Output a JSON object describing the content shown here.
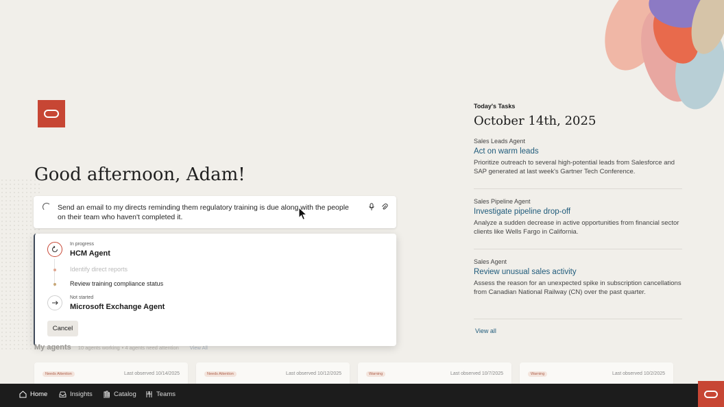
{
  "greeting": "Good afternoon, Adam!",
  "prompt": {
    "text": "Send an email to my directs reminding them regulatory training is due along with the people on their team who haven't completed it."
  },
  "progress": {
    "agents": [
      {
        "status": "In progress",
        "name": "HCM Agent",
        "steps": [
          {
            "label": "Identify direct reports",
            "state": "done"
          },
          {
            "label": "Review training compliance status",
            "state": "current"
          }
        ]
      },
      {
        "status": "Not started",
        "name": "Microsoft Exchange Agent",
        "steps": []
      }
    ],
    "cancel_label": "Cancel"
  },
  "my_agents": {
    "title": "My agents",
    "count": "10 agents working",
    "attention": "• 4 agents need attention",
    "view_all": "View All",
    "cards": [
      {
        "badge": "Needs Attention",
        "observed": "Last observed 10/14/2025"
      },
      {
        "badge": "Needs Attention",
        "observed": "Last observed 10/12/2025"
      },
      {
        "badge": "Warning",
        "observed": "Last observed 10/7/2025"
      },
      {
        "badge": "Warning",
        "observed": "Last observed 10/2/2025"
      }
    ]
  },
  "tasks": {
    "label": "Today's Tasks",
    "date": "October 14th, 2025",
    "items": [
      {
        "agent": "Sales Leads Agent",
        "title": "Act on warm leads",
        "description": "Prioritize outreach to several high-potential leads from Salesforce and SAP generated at last week's Gartner Tech Conference."
      },
      {
        "agent": "Sales Pipeline Agent",
        "title": "Investigate pipeline drop-off",
        "description": "Analyze a sudden decrease in active opportunities from financial sector clients like Wells Fargo in California."
      },
      {
        "agent": "Sales Agent",
        "title": "Review unusual sales activity",
        "description": "Assess the reason for an unexpected spike in subscription cancellations from Canadian National Railway (CN) over the past quarter."
      }
    ],
    "view_all": "View all"
  },
  "nav": [
    {
      "label": "Home",
      "icon": "home-icon",
      "active": true
    },
    {
      "label": "Insights",
      "icon": "inbox-icon",
      "active": false
    },
    {
      "label": "Catalog",
      "icon": "catalog-icon",
      "active": false
    },
    {
      "label": "Teams",
      "icon": "teams-icon",
      "active": false
    }
  ],
  "colors": {
    "brand": "#c74634",
    "link": "#1e5a7a",
    "background": "#f1efea",
    "nav_bar": "#1c1c1c"
  }
}
